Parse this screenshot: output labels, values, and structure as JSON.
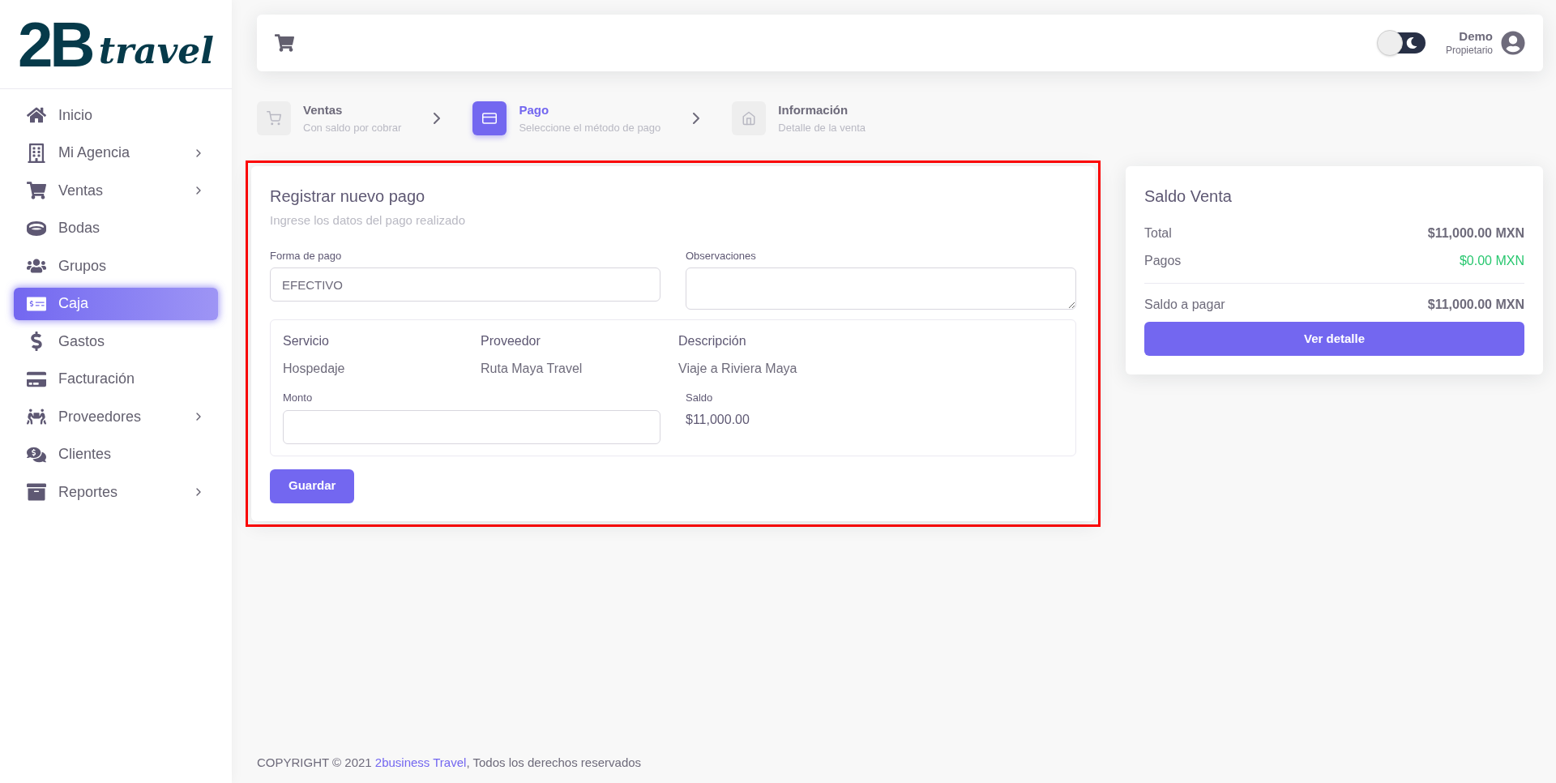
{
  "logo": {
    "mark": "2B",
    "word": "travel"
  },
  "sidebar": {
    "items": [
      {
        "label": "Inicio",
        "selected": false,
        "has_submenu": false
      },
      {
        "label": "Mi Agencia",
        "selected": false,
        "has_submenu": true
      },
      {
        "label": "Ventas",
        "selected": false,
        "has_submenu": true
      },
      {
        "label": "Bodas",
        "selected": false,
        "has_submenu": false
      },
      {
        "label": "Grupos",
        "selected": false,
        "has_submenu": false
      },
      {
        "label": "Caja",
        "selected": true,
        "has_submenu": false
      },
      {
        "label": "Gastos",
        "selected": false,
        "has_submenu": false
      },
      {
        "label": "Facturación",
        "selected": false,
        "has_submenu": false
      },
      {
        "label": "Proveedores",
        "selected": false,
        "has_submenu": true
      },
      {
        "label": "Clientes",
        "selected": false,
        "has_submenu": false
      },
      {
        "label": "Reportes",
        "selected": false,
        "has_submenu": true
      }
    ]
  },
  "header": {
    "dark_mode_toggle": {
      "on": false
    },
    "user": {
      "name": "Demo",
      "role": "Propietario"
    }
  },
  "steps": [
    {
      "title": "Ventas",
      "subtitle": "Con saldo por cobrar",
      "selected": false
    },
    {
      "title": "Pago",
      "subtitle": "Seleccione el método de pago",
      "selected": true
    },
    {
      "title": "Información",
      "subtitle": "Detalle de la venta",
      "selected": false
    }
  ],
  "payment_form": {
    "title": "Registrar nuevo pago",
    "subtitle": "Ingrese los datos del pago realizado",
    "payment_method": {
      "label": "Forma de pago",
      "value": "EFECTIVO"
    },
    "notes": {
      "label": "Observaciones"
    },
    "service": {
      "columns": [
        {
          "label": "Servicio",
          "value": "Hospedaje"
        },
        {
          "label": "Proveedor",
          "value": "Ruta Maya Travel"
        },
        {
          "label": "Descripción",
          "value": "Viaje a Riviera Maya"
        }
      ],
      "amount": {
        "label": "Monto"
      },
      "balance": {
        "label": "Saldo",
        "value": "$11,000.00"
      }
    },
    "save_button": "Guardar"
  },
  "summary": {
    "title": "Saldo Venta",
    "rows": [
      {
        "label": "Total",
        "value": "$11,000.00 MXN",
        "kind": "normal"
      },
      {
        "label": "Pagos",
        "value": "$0.00 MXN",
        "kind": "paid"
      },
      {
        "label": "Saldo a pagar",
        "value": "$11,000.00 MXN",
        "kind": "total"
      }
    ],
    "button": "Ver detalle"
  },
  "footer": {
    "prefix": "COPYRIGHT © 2021 ",
    "link": "2business Travel",
    "suffix": ", Todos los derechos reservados"
  }
}
